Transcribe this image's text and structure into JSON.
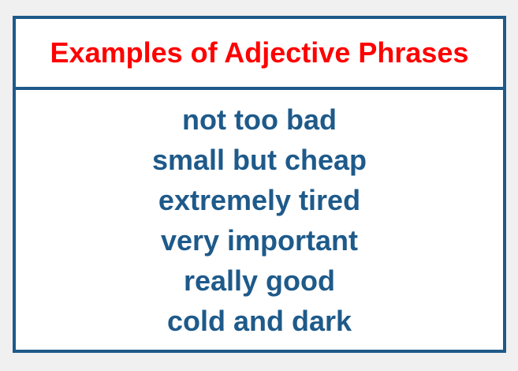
{
  "title": "Examples of Adjective Phrases",
  "colors": {
    "title": "#ff0000",
    "phrases": "#1e5a8a",
    "border": "#1e5a8a",
    "background": "#f0f0f0"
  },
  "phrases": [
    "not too bad",
    "small but cheap",
    "extremely tired",
    "very important",
    "really good",
    "cold and dark"
  ]
}
